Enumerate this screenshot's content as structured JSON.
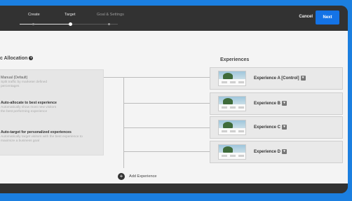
{
  "header": {
    "steps": [
      {
        "label": "Create"
      },
      {
        "label": "Target"
      },
      {
        "label": "Goal & Settings"
      }
    ],
    "cancel_label": "Cancel",
    "next_label": "Next"
  },
  "allocation": {
    "title": "c Allocation",
    "info_glyph": "?",
    "options": [
      {
        "title": "Manual (Default)",
        "desc": "Split traffic by marketer defined percentages"
      },
      {
        "title": "Auto-allocate to best experience",
        "desc": "Automatically show most new visitors the best performing experience"
      },
      {
        "title": "Auto-target for personalized experiences",
        "desc": "Automatically target visitors with the best experience to maximize a business goal"
      }
    ]
  },
  "experiences": {
    "title": "Experiences",
    "items": [
      {
        "name": "Experience A [Control]"
      },
      {
        "name": "Experience B"
      },
      {
        "name": "Experience C"
      },
      {
        "name": "Experience D"
      }
    ],
    "caret_glyph": "▾",
    "add_label": "Add Experience",
    "add_glyph": "+"
  },
  "colors": {
    "background": "#1b7fe0",
    "frame": "#2f2f2f",
    "next_button": "#1473e6"
  }
}
